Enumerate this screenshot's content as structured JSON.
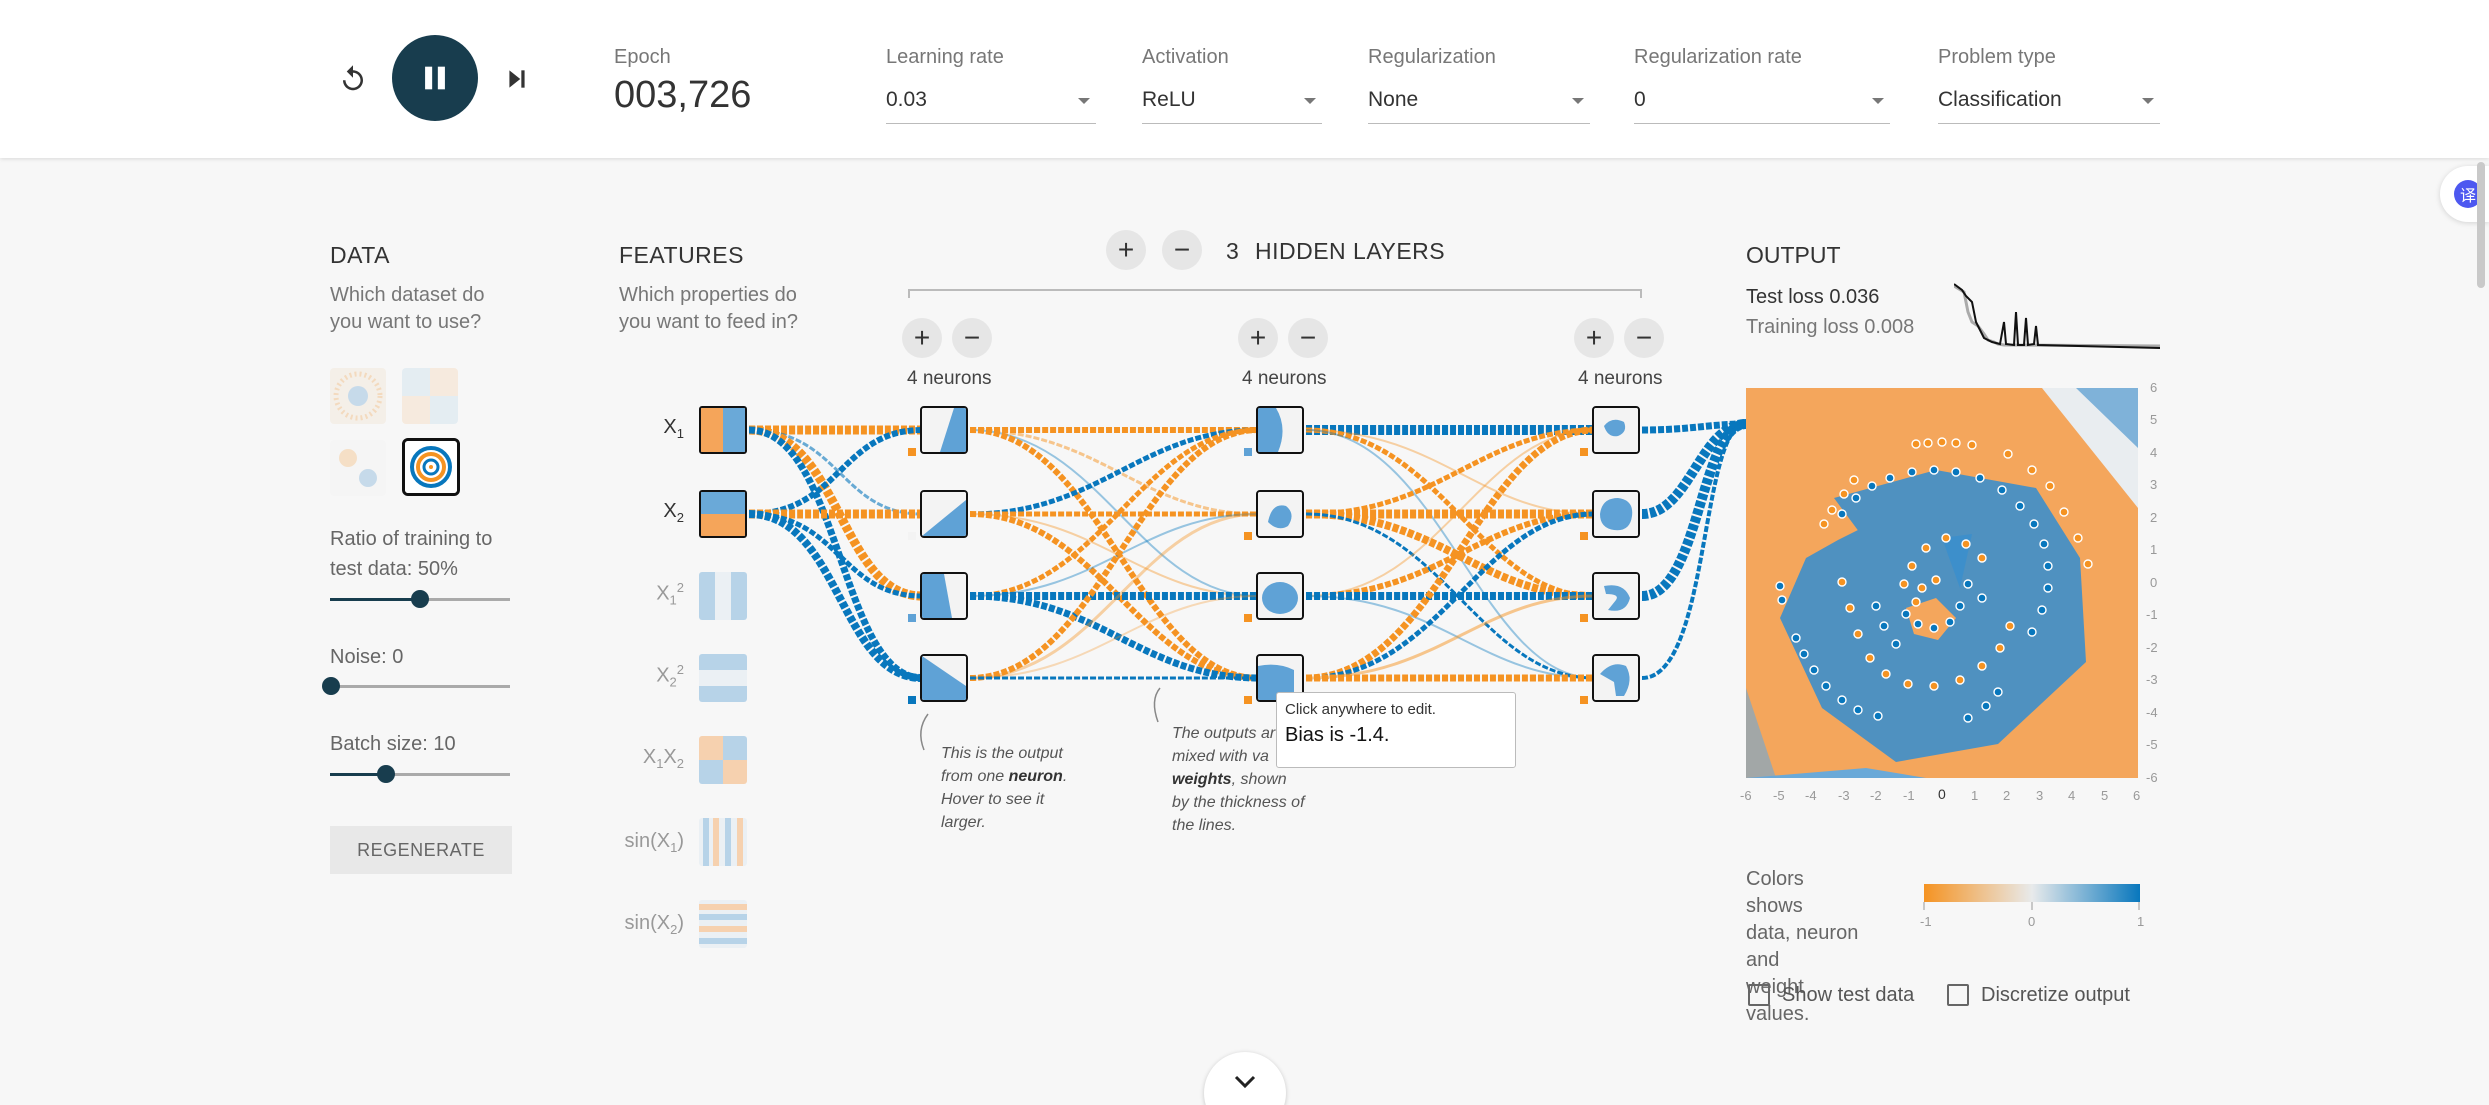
{
  "controls": {
    "epoch_label": "Epoch",
    "epoch_value": "003,726",
    "learning_rate": {
      "label": "Learning rate",
      "value": "0.03"
    },
    "activation": {
      "label": "Activation",
      "value": "ReLU"
    },
    "regularization": {
      "label": "Regularization",
      "value": "None"
    },
    "regularization_rate": {
      "label": "Regularization rate",
      "value": "0"
    },
    "problem_type": {
      "label": "Problem type",
      "value": "Classification"
    }
  },
  "translate_badge": "译",
  "data_panel": {
    "title": "DATA",
    "subtitle_1": "Which dataset do",
    "subtitle_2": "you want to use?",
    "datasets": [
      "circle",
      "xor",
      "gaussian",
      "spiral"
    ],
    "selected_dataset": "spiral",
    "ratio_label_1": "Ratio of training to",
    "ratio_label_2": "test data:  50%",
    "ratio_value": 50,
    "noise_label": "Noise:  0",
    "noise_value": 0,
    "batch_label": "Batch size:  10",
    "batch_value": 10,
    "regenerate": "REGENERATE"
  },
  "features_panel": {
    "title": "FEATURES",
    "subtitle_1": "Which properties do",
    "subtitle_2": "you want to feed in?",
    "features": [
      {
        "base": "X",
        "sub": "1",
        "sup": "",
        "active": true
      },
      {
        "base": "X",
        "sub": "2",
        "sup": "",
        "active": true
      },
      {
        "base": "X",
        "sub": "1",
        "sup": "2",
        "active": false
      },
      {
        "base": "X",
        "sub": "2",
        "sup": "2",
        "active": false
      },
      {
        "base": "X",
        "sub": "1",
        "base2": "X",
        "sub2": "2",
        "active": false
      },
      {
        "base": "sin(X",
        "sub": "1",
        "tail": ")",
        "active": false
      },
      {
        "base": "sin(X",
        "sub": "2",
        "tail": ")",
        "active": false
      }
    ]
  },
  "network": {
    "hidden_layers_count": "3",
    "hidden_layers_label": "HIDDEN LAYERS",
    "layers": [
      {
        "neurons_label": "4 neurons"
      },
      {
        "neurons_label": "4 neurons"
      },
      {
        "neurons_label": "4 neurons"
      }
    ],
    "note_neuron_1": "This is the output",
    "note_neuron_2": "from one",
    "note_neuron_bold": "neuron",
    "note_neuron_3": "Hover to see it",
    "note_neuron_4": "larger.",
    "note_weights_1": "The outputs ar",
    "note_weights_2": "mixed with va",
    "note_weights_bold": "weights",
    "note_weights_3": ", shown",
    "note_weights_4": "by the thickness of",
    "note_weights_5": "the lines."
  },
  "tooltip": {
    "hint": "Click anywhere to edit.",
    "text": "Bias is -1.4."
  },
  "output_panel": {
    "title": "OUTPUT",
    "test_loss": "Test loss 0.036",
    "training_loss": "Training loss 0.008",
    "y_ticks": [
      "6",
      "5",
      "4",
      "3",
      "2",
      "1",
      "0",
      "-1",
      "-2",
      "-3",
      "-4",
      "-5",
      "-6"
    ],
    "x_ticks": [
      "-6",
      "-5",
      "-4",
      "-3",
      "-2",
      "-1",
      "0",
      "1",
      "2",
      "3",
      "4",
      "5",
      "6"
    ],
    "legend_text_1": "Colors shows",
    "legend_text_2": "data, neuron and",
    "legend_text_3": "weight values.",
    "legend_ticks": [
      "-1",
      "0",
      "1"
    ],
    "show_test_data": "Show test data",
    "discretize_output": "Discretize output"
  },
  "colors": {
    "orange": "#f59322",
    "blue": "#0877bd",
    "dark": "#183d4e"
  }
}
